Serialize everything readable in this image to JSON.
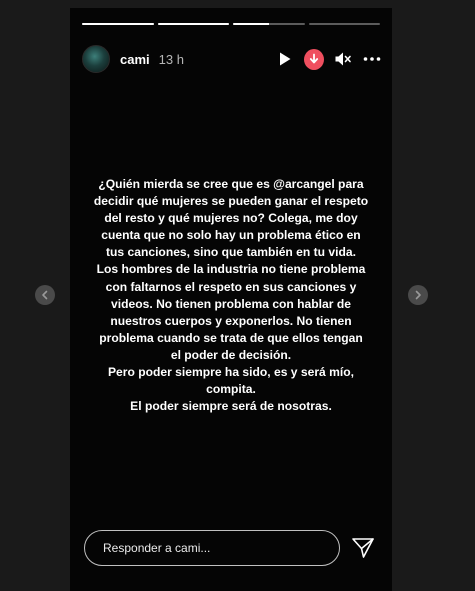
{
  "progress": {
    "segments": [
      1,
      1,
      0.5,
      0
    ]
  },
  "header": {
    "username": "cami",
    "time": "13 h"
  },
  "story": {
    "text": "¿Quién mierda se cree que es @arcangel para\ndecidir qué mujeres se pueden ganar el respeto\ndel resto y qué mujeres no? Colega, me doy\ncuenta que no solo hay un problema ético en\ntus canciones, sino que también en tu vida.\nLos hombres de la industria no tiene problema\ncon faltarnos el respeto en sus canciones y\nvideos. No tienen problema con hablar de\nnuestros cuerpos y exponerlos. No tienen\nproblema cuando se trata de que ellos tengan\nel poder de decisión.\nPero poder siempre ha sido, es y será mío,\ncompita.\nEl poder siempre será de nosotras."
  },
  "reply": {
    "placeholder": "Responder a cami..."
  },
  "icons": {
    "play": "play-icon",
    "record": "record-icon",
    "mute": "speaker-muted-icon",
    "more": "more-options-icon",
    "send": "send-icon",
    "prev": "chevron-left-icon",
    "next": "chevron-right-icon"
  },
  "colors": {
    "story_background": "#050505",
    "viewer_background": "#1a1a1a",
    "record_badge": "#ef4f5f",
    "text": "#ffffff"
  }
}
